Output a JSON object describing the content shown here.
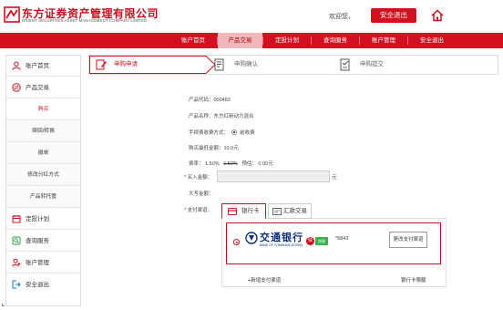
{
  "header": {
    "logo_cn": "东方证券资产管理有限公司",
    "logo_en": "ORIENT SECURITIES ASSET MANAGEMENT COMPANY LIMITED",
    "welcome": "欢迎您，",
    "logout_label": "安全退出",
    "home_icon": "home-icon"
  },
  "nav": {
    "items": [
      {
        "label": "账户首页"
      },
      {
        "label": "产品交易"
      },
      {
        "label": "定投计划"
      },
      {
        "label": "查询服务"
      },
      {
        "label": "账户管理"
      },
      {
        "label": "安全退出"
      }
    ],
    "active_index": 1
  },
  "sidebar": {
    "items": [
      {
        "label": "账户首页",
        "icon": "user-icon"
      },
      {
        "label": "产品交易",
        "icon": "exchange-icon"
      },
      {
        "label": "定投计划",
        "icon": "calendar-icon"
      },
      {
        "label": "查询服务",
        "icon": "search-icon"
      },
      {
        "label": "账户管理",
        "icon": "account-icon"
      },
      {
        "label": "安全退出",
        "icon": "logout-icon"
      }
    ],
    "sub_items": [
      {
        "label": "购买"
      },
      {
        "label": "赎回/转换"
      },
      {
        "label": "撤单"
      },
      {
        "label": "修改分红方式"
      },
      {
        "label": "产品转托管"
      }
    ],
    "active_sub": 0
  },
  "steps": [
    {
      "label": "申购申请",
      "icon": "edit-icon"
    },
    {
      "label": "申购确认",
      "icon": "document-icon"
    },
    {
      "label": "申购提交",
      "icon": "checklist-icon"
    }
  ],
  "form": {
    "product_code": "产品代码：000483",
    "product_name": "产品名称：东方红新动力混合",
    "fee_method_label": "手续费收费方式：",
    "fee_method_option": "前收费",
    "min_purchase": "购买最低金额：10.0元",
    "rate_label": "费率：",
    "rate_value": "1.50%",
    "rate_original": "1.50%",
    "rate_discount_label": "预估：",
    "rate_discount": "0.00元",
    "amount_label": "买入金额：",
    "amount_placeholder": "",
    "amount_unit": "元",
    "amount_caps_label": "大写金额：",
    "pay_channel_label": "支付渠道："
  },
  "payment": {
    "tabs": [
      {
        "label": "银行卡",
        "icon": "card-icon"
      },
      {
        "label": "汇款交易",
        "icon": "transfer-icon"
      }
    ],
    "active_tab": 0,
    "bank": {
      "name": "交通银行",
      "name_en": "BANK OF COMMUNICATIONS",
      "badge": "快",
      "tag": "快捷",
      "card": "*8843",
      "change_label": "更改支付渠道"
    },
    "add_channel": "+新增支付渠道",
    "limit_link": "银行卡限额"
  },
  "colors": {
    "brand_red": "#d3101f",
    "bank_blue": "#0a2f7c"
  }
}
